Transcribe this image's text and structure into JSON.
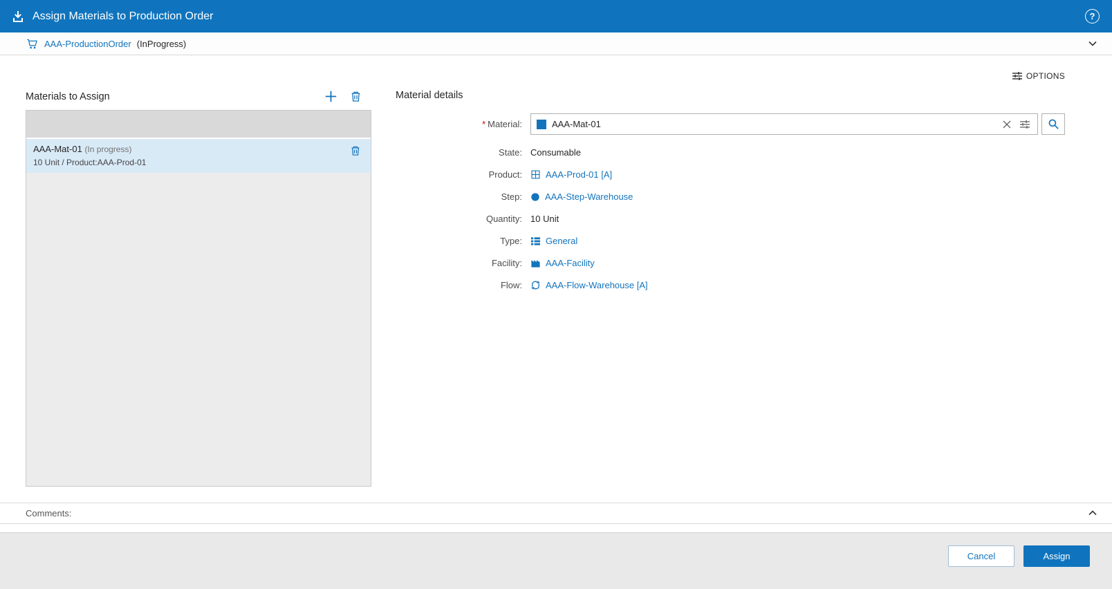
{
  "colors": {
    "header_bg": "#0f74bd",
    "link_blue": "#1374bc",
    "selected_row_bg": "#d9eaf7",
    "list_header_bg": "#d9d9d9",
    "list_bg": "#ececec",
    "footer_bg": "#e9e9e9",
    "assign_button_bg": "#0f74bd",
    "required_marker_color": "#cc0000"
  },
  "header": {
    "title": "Assign Materials to Production Order",
    "help_glyph": "?"
  },
  "order_bar": {
    "name": "AAA-ProductionOrder",
    "status": "(InProgress)"
  },
  "toolbar": {
    "options_label": "OPTIONS"
  },
  "materials_panel": {
    "title": "Materials to Assign",
    "items": [
      {
        "name": "AAA-Mat-01",
        "status": "(In progress)",
        "detail": "10 Unit / Product:AAA-Prod-01"
      }
    ]
  },
  "details_panel": {
    "title": "Material details",
    "required_marker": "*",
    "material": {
      "label": "Material:",
      "value": "AAA-Mat-01"
    },
    "state": {
      "label": "State:",
      "value": "Consumable"
    },
    "product": {
      "label": "Product:",
      "value": "AAA-Prod-01 [A]"
    },
    "step": {
      "label": "Step:",
      "value": "AAA-Step-Warehouse"
    },
    "quantity": {
      "label": "Quantity:",
      "value": "10 Unit"
    },
    "type": {
      "label": "Type:",
      "value": "General"
    },
    "facility": {
      "label": "Facility:",
      "value": "AAA-Facility"
    },
    "flow": {
      "label": "Flow:",
      "value": "AAA-Flow-Warehouse [A]"
    }
  },
  "comments": {
    "label": "Comments:"
  },
  "footer": {
    "cancel_label": "Cancel",
    "assign_label": "Assign"
  }
}
